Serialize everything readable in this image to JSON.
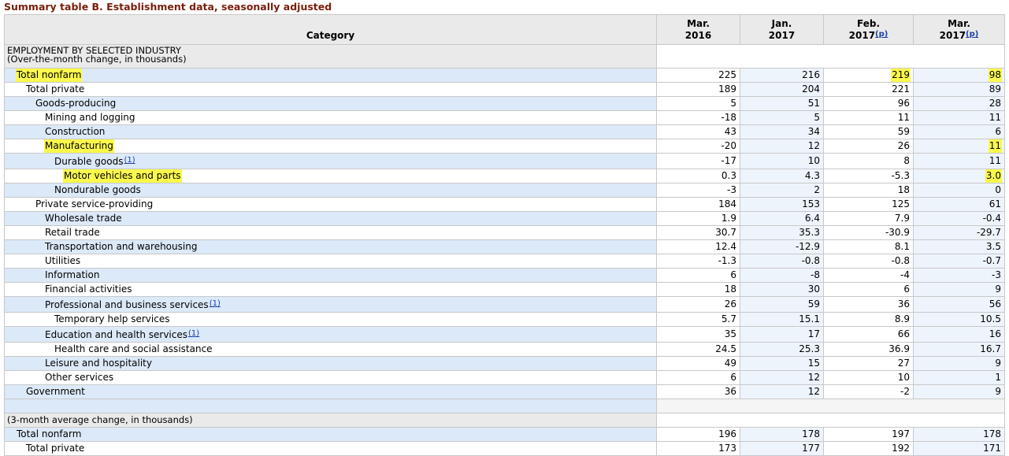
{
  "caption": "Summary table B. Establishment data, seasonally adjusted",
  "header": {
    "category": "Category",
    "cols": [
      {
        "line1": "Mar.",
        "line2": "2016",
        "note": ""
      },
      {
        "line1": "Jan.",
        "line2": "2017",
        "note": ""
      },
      {
        "line1": "Feb.",
        "line2": "2017",
        "note": "(p)"
      },
      {
        "line1": "Mar.",
        "line2": "2017",
        "note": "(p)"
      }
    ]
  },
  "section1": {
    "title": "EMPLOYMENT BY SELECTED INDUSTRY",
    "subtitle": "(Over-the-month change, in thousands)"
  },
  "rows": [
    {
      "label": "Total nonfarm",
      "note": "",
      "indent": 1,
      "values": [
        "225",
        "216",
        "219",
        "98"
      ],
      "highlight_label": true,
      "highlight_values": [
        false,
        false,
        true,
        true
      ]
    },
    {
      "label": "Total private",
      "note": "",
      "indent": 2,
      "values": [
        "189",
        "204",
        "221",
        "89"
      ],
      "highlight_label": false,
      "highlight_values": [
        false,
        false,
        false,
        false
      ]
    },
    {
      "label": "Goods-producing",
      "note": "",
      "indent": 3,
      "values": [
        "5",
        "51",
        "96",
        "28"
      ],
      "highlight_label": false,
      "highlight_values": [
        false,
        false,
        false,
        false
      ]
    },
    {
      "label": "Mining and logging",
      "note": "",
      "indent": 4,
      "values": [
        "-18",
        "5",
        "11",
        "11"
      ],
      "highlight_label": false,
      "highlight_values": [
        false,
        false,
        false,
        false
      ]
    },
    {
      "label": "Construction",
      "note": "",
      "indent": 4,
      "values": [
        "43",
        "34",
        "59",
        "6"
      ],
      "highlight_label": false,
      "highlight_values": [
        false,
        false,
        false,
        false
      ]
    },
    {
      "label": "Manufacturing",
      "note": "",
      "indent": 4,
      "values": [
        "-20",
        "12",
        "26",
        "11"
      ],
      "highlight_label": true,
      "highlight_values": [
        false,
        false,
        false,
        true
      ]
    },
    {
      "label": "Durable goods",
      "note": "(1)",
      "indent": 5,
      "values": [
        "-17",
        "10",
        "8",
        "11"
      ],
      "highlight_label": false,
      "highlight_values": [
        false,
        false,
        false,
        false
      ]
    },
    {
      "label": "Motor vehicles and parts",
      "note": "",
      "indent": 6,
      "values": [
        "0.3",
        "4.3",
        "-5.3",
        "3.0"
      ],
      "highlight_label": true,
      "highlight_values": [
        false,
        false,
        false,
        true
      ]
    },
    {
      "label": "Nondurable goods",
      "note": "",
      "indent": 5,
      "values": [
        "-3",
        "2",
        "18",
        "0"
      ],
      "highlight_label": false,
      "highlight_values": [
        false,
        false,
        false,
        false
      ]
    },
    {
      "label": "Private service-providing",
      "note": "",
      "indent": 3,
      "values": [
        "184",
        "153",
        "125",
        "61"
      ],
      "highlight_label": false,
      "highlight_values": [
        false,
        false,
        false,
        false
      ]
    },
    {
      "label": "Wholesale trade",
      "note": "",
      "indent": 4,
      "values": [
        "1.9",
        "6.4",
        "7.9",
        "-0.4"
      ],
      "highlight_label": false,
      "highlight_values": [
        false,
        false,
        false,
        false
      ]
    },
    {
      "label": "Retail trade",
      "note": "",
      "indent": 4,
      "values": [
        "30.7",
        "35.3",
        "-30.9",
        "-29.7"
      ],
      "highlight_label": false,
      "highlight_values": [
        false,
        false,
        false,
        false
      ]
    },
    {
      "label": "Transportation and warehousing",
      "note": "",
      "indent": 4,
      "values": [
        "12.4",
        "-12.9",
        "8.1",
        "3.5"
      ],
      "highlight_label": false,
      "highlight_values": [
        false,
        false,
        false,
        false
      ]
    },
    {
      "label": "Utilities",
      "note": "",
      "indent": 4,
      "values": [
        "-1.3",
        "-0.8",
        "-0.8",
        "-0.7"
      ],
      "highlight_label": false,
      "highlight_values": [
        false,
        false,
        false,
        false
      ]
    },
    {
      "label": "Information",
      "note": "",
      "indent": 4,
      "values": [
        "6",
        "-8",
        "-4",
        "-3"
      ],
      "highlight_label": false,
      "highlight_values": [
        false,
        false,
        false,
        false
      ]
    },
    {
      "label": "Financial activities",
      "note": "",
      "indent": 4,
      "values": [
        "18",
        "30",
        "6",
        "9"
      ],
      "highlight_label": false,
      "highlight_values": [
        false,
        false,
        false,
        false
      ]
    },
    {
      "label": "Professional and business services",
      "note": "(1)",
      "indent": 4,
      "values": [
        "26",
        "59",
        "36",
        "56"
      ],
      "highlight_label": false,
      "highlight_values": [
        false,
        false,
        false,
        false
      ]
    },
    {
      "label": "Temporary help services",
      "note": "",
      "indent": 5,
      "values": [
        "5.7",
        "15.1",
        "8.9",
        "10.5"
      ],
      "highlight_label": false,
      "highlight_values": [
        false,
        false,
        false,
        false
      ]
    },
    {
      "label": "Education and health services",
      "note": "(1)",
      "indent": 4,
      "values": [
        "35",
        "17",
        "66",
        "16"
      ],
      "highlight_label": false,
      "highlight_values": [
        false,
        false,
        false,
        false
      ]
    },
    {
      "label": "Health care and social assistance",
      "note": "",
      "indent": 5,
      "values": [
        "24.5",
        "25.3",
        "36.9",
        "16.7"
      ],
      "highlight_label": false,
      "highlight_values": [
        false,
        false,
        false,
        false
      ]
    },
    {
      "label": "Leisure and hospitality",
      "note": "",
      "indent": 4,
      "values": [
        "49",
        "15",
        "27",
        "9"
      ],
      "highlight_label": false,
      "highlight_values": [
        false,
        false,
        false,
        false
      ]
    },
    {
      "label": "Other services",
      "note": "",
      "indent": 4,
      "values": [
        "6",
        "12",
        "10",
        "1"
      ],
      "highlight_label": false,
      "highlight_values": [
        false,
        false,
        false,
        false
      ]
    },
    {
      "label": "Government",
      "note": "",
      "indent": 2,
      "values": [
        "36",
        "12",
        "-2",
        "9"
      ],
      "highlight_label": false,
      "highlight_values": [
        false,
        false,
        false,
        false
      ]
    }
  ],
  "section2": {
    "title": "(3-month average change, in thousands)"
  },
  "rows2": [
    {
      "label": "Total nonfarm",
      "note": "",
      "indent": 1,
      "values": [
        "196",
        "178",
        "197",
        "178"
      ],
      "highlight_label": false,
      "highlight_values": [
        false,
        false,
        false,
        false
      ]
    },
    {
      "label": "Total private",
      "note": "",
      "indent": 2,
      "values": [
        "173",
        "177",
        "192",
        "171"
      ],
      "highlight_label": false,
      "highlight_values": [
        false,
        false,
        false,
        false
      ]
    }
  ],
  "colors": {
    "caption": "#7a1e0c",
    "row_blue": "#dce9f8",
    "header_gray": "#eaeaea",
    "highlight": "#fbf94c",
    "footnote_link": "#1a3fa8"
  }
}
